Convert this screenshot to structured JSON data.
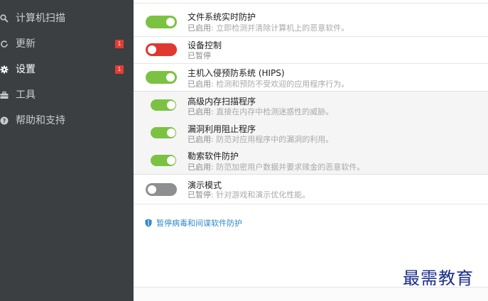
{
  "sidebar": {
    "items": [
      {
        "label": "计算机扫描",
        "icon": "search-icon"
      },
      {
        "label": "更新",
        "icon": "refresh-icon",
        "badge": "1"
      },
      {
        "label": "设置",
        "icon": "gear-icon",
        "badge": "1",
        "active": true
      },
      {
        "label": "工具",
        "icon": "toolbox-icon"
      },
      {
        "label": "帮助和支持",
        "icon": "help-icon"
      }
    ]
  },
  "features": [
    {
      "title": "文件系统实时防护",
      "status": "已启用",
      "desc": ": 立即检测并清除计算机上的恶意软件。",
      "state": "on"
    },
    {
      "title": "设备控制",
      "status": "已暂停",
      "desc": "",
      "state": "off"
    },
    {
      "title": "主机入侵预防系统 (HIPS)",
      "status": "已启用",
      "desc": ": 检测和预防不受欢迎的应用程序行为。",
      "state": "on"
    },
    {
      "title": "高级内存扫描程序",
      "status": "已启用",
      "desc": ": 直接在内存中检测迷惑性的威胁。",
      "state": "on"
    },
    {
      "title": "漏洞利用阻止程序",
      "status": "已启用",
      "desc": ": 防范对应用程序中的漏洞的利用。",
      "state": "on"
    },
    {
      "title": "勒索软件防护",
      "status": "已启用",
      "desc": ": 防范加密用户数据并要求赎金的恶意软件。",
      "state": "on"
    },
    {
      "title": "演示模式",
      "status": "已暂停",
      "desc": ": 针对游戏和演示优化性能。",
      "state": "gray"
    }
  ],
  "pause_link": "暂停病毒和间谍软件防护",
  "watermark": "最需教育",
  "colors": {
    "sidebar_bg": "#3b3f42",
    "toggle_on": "#7cc242",
    "toggle_off": "#e0372f",
    "toggle_paused": "#8d8f91",
    "badge": "#e23c32",
    "link": "#2f88c9",
    "watermark": "#1a2d8a"
  }
}
